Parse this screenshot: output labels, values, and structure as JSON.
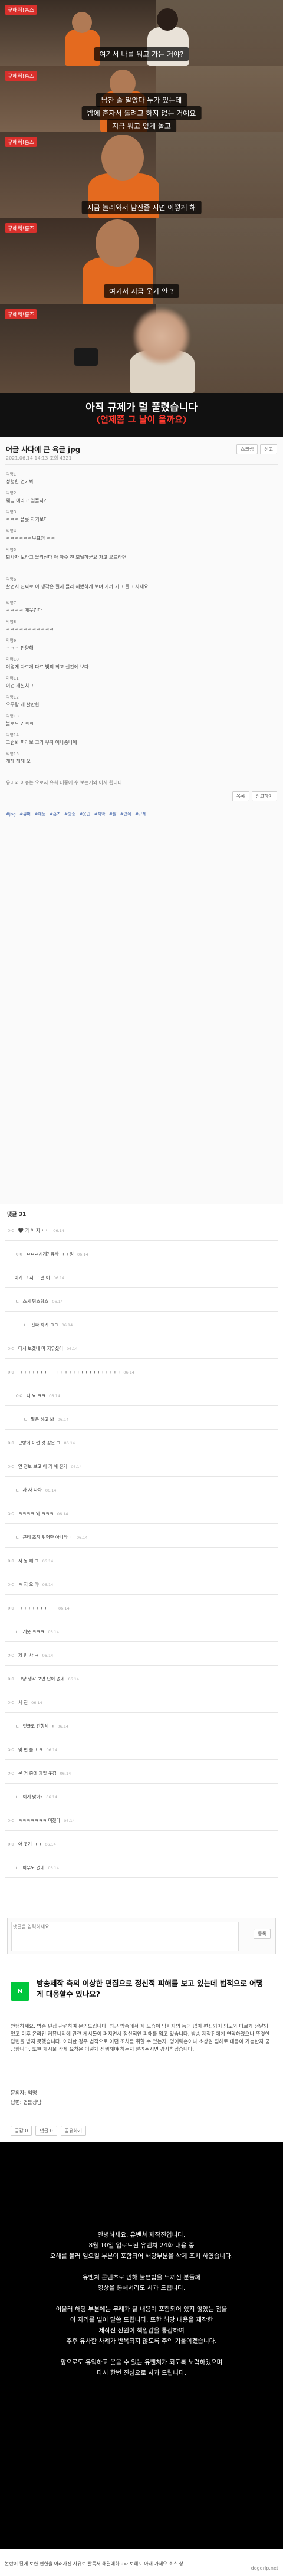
{
  "scene_subtitles": {
    "s1": "여기서 나를 뭐고 가는 거야?",
    "s2a": "남잔 줄 알았다 누가 있는데",
    "s2b": "밤에 혼자서 돌려고 하지 없는 거예요",
    "s2c": "지금 뭐고 있게 놀고",
    "s3": "지금 놀러와서 남잔줄 지면 어떻게 해",
    "s4": "여기서 지금 웃기 안 ?"
  },
  "program_logo": "구해줘!홈즈",
  "caption": {
    "line1": "아직 규제가 덜 풀렸습니다",
    "line2": "(언제쯤 그 날이 올까요)"
  },
  "board": {
    "title": "어글 사다에 큰 욕글 jpg",
    "meta": "2021.06.14 14:13 조회 4321",
    "actions": [
      "스크랩",
      "신고"
    ],
    "comments": [
      {
        "nick": "익명1",
        "text": "성형한 언가봐"
      },
      {
        "nick": "익명2",
        "text": "웨딩 예라고 임플치?"
      },
      {
        "nick": "익명3",
        "text": "ㅋㅋㅋ 플롯 자기보다"
      },
      {
        "nick": "익명4",
        "text": "ㅋㅋㅋㅋㅋㅋ무표정 ㅋㅋ"
      },
      {
        "nick": "익명5",
        "text": "퇴사자 보라고 올리신다 아 아주 진 모델하군요 자고 오르라면"
      },
      {
        "nick": "익명6",
        "text": "살면서 진짜로 이 생각은 될지 몰라 해봤하게 보며 가까 키고 들고 사세요"
      },
      {
        "nick": "익명7",
        "text": "ㅋㅋㅋㅋ 개웃긴다"
      },
      {
        "nick": "익명8",
        "text": "ㅋㅋㅋㅋㅋㅋㅋㅋㅋㅋㅋ"
      },
      {
        "nick": "익명9",
        "text": "ㅋㅋㅋ 판양해"
      },
      {
        "nick": "익명10",
        "text": "이렇게 다르게 다르 빛의 최고 실간에 보다"
      },
      {
        "nick": "익명11",
        "text": "이건 개설치고 "
      },
      {
        "nick": "익명12",
        "text": "오무랑 개 살만한 "
      },
      {
        "nick": "익명13",
        "text": "블로드 2 ㅋㅋ"
      },
      {
        "nick": "익명14",
        "text": "그럼봐 꺼라보 그거 무하 어나중나에"
      },
      {
        "nick": "익명15",
        "text": "레헤 헤헤 오"
      }
    ],
    "footer_note": "유머와 이슈는 오로지 유희 대중에 수 보는거와 어서 됩니다",
    "buttons": [
      "목록",
      "신고하기"
    ],
    "tags": [
      "#jpg",
      "#유머",
      "#예능",
      "#홈즈",
      "#방송",
      "#웃긴",
      "#자막",
      "#짤",
      "#연예",
      "#규제"
    ]
  },
  "comment_list": {
    "header": "댓글 31",
    "items": [
      {
        "nick": "ㅇㅇ",
        "text": "🖤 가 이 저 ㄴㄴ",
        "date": "06.14"
      },
      {
        "nick": "ㅇㅇ",
        "text": "ㅁㅁㄹ시계? 유사 ㅋㅋ 빙",
        "date": "06.14"
      },
      {
        "nick": "ㄴ",
        "text": "이거 그 저 고 걸 어",
        "date": "06.14"
      },
      {
        "nick": "ㄴ",
        "text": "스시 탕스탕스",
        "date": "06.14"
      },
      {
        "nick": "ㄴ",
        "text": "진짜 하게 ㅋㅋ",
        "date": "06.14"
      },
      {
        "nick": "ㅇㅇ",
        "text": "다시 보겠네 마 저우셨어",
        "date": "06.14"
      },
      {
        "nick": "ㅇㅇ",
        "text": "ㅋㅋㅋㅋㅋㅋㅋㅋㅋㅋㅋㅋㅋㅋㅋㅋㅋㅋㅋㅋㅋㅋㅋㅋㅋ",
        "date": "06.14"
      },
      {
        "nick": "ㅇㅇ",
        "text": "너 요 ㅋㅋ",
        "date": "06.14"
      },
      {
        "nick": "ㄴ",
        "text": "말은 하고 봐",
        "date": "06.14"
      },
      {
        "nick": "ㅇㅇ",
        "text": "근방에 이런 것 같은 ㅋ",
        "date": "06.14"
      },
      {
        "nick": "ㅇㅇ",
        "text": "언 정보 보고 이 가 해 진거",
        "date": "06.14"
      },
      {
        "nick": "ㄴ",
        "text": "사 사 나다",
        "date": "06.14"
      },
      {
        "nick": "ㅇㅇ",
        "text": "ㅋㅋㅋㅋ 와 ㅋㅋㅋ",
        "date": "06.14"
      },
      {
        "nick": "ㄴ",
        "text": "근데 조작 위험한 아니라 ㄷ",
        "date": "06.14"
      },
      {
        "nick": "ㅇㅇ",
        "text": "저 동 해 ㅋ",
        "date": "06.14"
      },
      {
        "nick": "ㅇㅇ",
        "text": "ㅋ 저 오 야",
        "date": "06.14"
      },
      {
        "nick": "ㅇㅇ",
        "text": "ㅋㅋㅋㅋㅋㅋㅋㅋㅋ",
        "date": "06.14"
      },
      {
        "nick": "ㄴ",
        "text": "개웃 ㅋㅋㅋ",
        "date": "06.14"
      },
      {
        "nick": "ㅇㅇ",
        "text": "제 방 사 ㅋ",
        "date": "06.14"
      },
      {
        "nick": "ㅇㅇ",
        "text": "그냥 생각 보면 답이 없네",
        "date": "06.14"
      },
      {
        "nick": "ㅇㅇ",
        "text": "사 진",
        "date": "06.14"
      },
      {
        "nick": "ㄴ",
        "text": "댓글로 진행해 ㅋ",
        "date": "06.14"
      },
      {
        "nick": "ㅇㅇ",
        "text": "몇 편 돌고 ㅋ",
        "date": "06.14"
      },
      {
        "nick": "ㅇㅇ",
        "text": "본 거 중에 제일 웃김",
        "date": "06.14"
      },
      {
        "nick": "ㄴ",
        "text": "이게 맞아?",
        "date": "06.14"
      },
      {
        "nick": "ㅇㅇ",
        "text": "ㅋㅋㅋㅋㅋㅋㅋ 미쳤다",
        "date": "06.14"
      },
      {
        "nick": "ㅇㅇ",
        "text": "아 웃겨 ㅋㅋ",
        "date": "06.14"
      },
      {
        "nick": "ㄴ",
        "text": "아무도 없네",
        "date": "06.14"
      }
    ],
    "input_placeholder": "댓글을 입력하세요",
    "submit": "등록"
  },
  "notice": {
    "badge": "N",
    "title": "방송제작 측의 이상한 편집으로 정신적 피해를 보고 있는데 법적으로 어떻게 대응할수 있나요?",
    "body": "안녕하세요. 방송 편집 관련하여 문의드립니다. 최근 방송에서 제 모습이 당사자의 동의 없이 편집되어 의도와 다르게 전달되었고 이후 온라인 커뮤니티에 관련 게시물이 퍼지면서 정신적인 피해를 입고 있습니다. 방송 제작진에게 연락하였으나 뚜렷한 답변을 받지 못했습니다. 이러한 경우 법적으로 어떤 조치를 취할 수 있는지, 명예훼손이나 초상권 침해로 대응이 가능한지 궁금합니다. 또한 게시물 삭제 요청은 어떻게 진행해야 하는지 알려주시면 감사하겠습니다.",
    "sign1": "문의자: 익명",
    "sign2": "답변: 법률상담",
    "footer": [
      "공감 0",
      "댓글 0",
      "공유하기"
    ]
  },
  "black_panel": {
    "lines": [
      "안녕하세요. 유밴쳐 제작진입니다.",
      "8월 10일 업로드된 유밴쳐 24화 내용 중",
      "오해를 불러 일으킬 부분이 포함되어 해당부분을 삭제 조치 하였습니다.",
      "",
      "유밴쳐 콘텐츠로 인해 불편함을 느끼신 분들께",
      "영상을 통해서라도 사과 드립니다.",
      "",
      "이울러 해당 부분에는 무례가 될 내용이 포함되어 있지 않았는 점을",
      "이 자리를 빌어 말씀 드립니다. 또한 해당 내용을 제작한",
      "제작진 전원이 책임감을 통감하여",
      "추후 유사한 사례가 반복되지 않도록 주의 기울이겠습니다.",
      "",
      "앞으로도 유익하고 웃음 수 있는 유밴쳐가 되도록 노력하겠으며",
      "다시 한번 진심으로 사과 드립니다."
    ]
  },
  "bottom_caption": "논란이 된게 토한 면한을 아래사진 사유로 빨독서 해결에하고라 토해도 아래 가세요 소스 상",
  "brand": "dogdrip.net"
}
